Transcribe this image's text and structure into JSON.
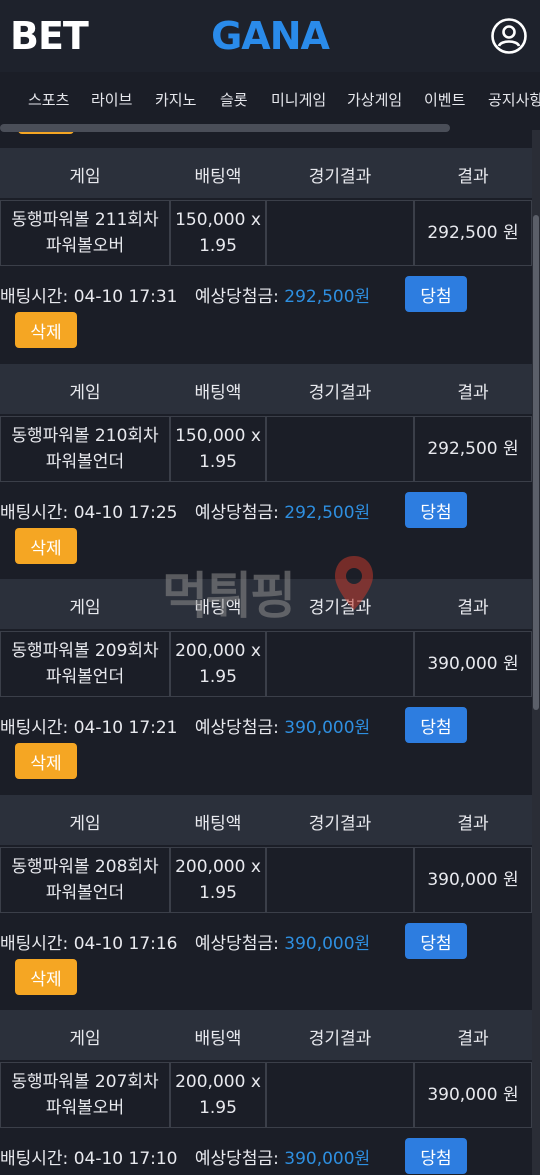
{
  "brand": {
    "logo_part1": "GANA",
    "logo_part2": "BET"
  },
  "nav": {
    "items": [
      "스포츠",
      "라이브",
      "카지노",
      "슬롯",
      "미니게임",
      "가상게임",
      "이벤트",
      "공지사항"
    ]
  },
  "table_headers": [
    "게임",
    "배팅액",
    "경기결과",
    "결과"
  ],
  "labels": {
    "bet_time": "배팅시간:",
    "expected_win": "예상당첨금:",
    "win_button": "당첨",
    "delete_button": "삭제"
  },
  "bets": [
    {
      "game_line1": "동행파워볼 211회차",
      "game_line2": "파워볼오버",
      "amount_line1": "150,000 x",
      "amount_line2": "1.95",
      "match_result": "",
      "result": "292,500 원",
      "bet_time": "04-10 17:31",
      "expected_win": "292,500원"
    },
    {
      "game_line1": "동행파워볼 210회차",
      "game_line2": "파워볼언더",
      "amount_line1": "150,000 x",
      "amount_line2": "1.95",
      "match_result": "",
      "result": "292,500 원",
      "bet_time": "04-10 17:25",
      "expected_win": "292,500원"
    },
    {
      "game_line1": "동행파워볼 209회차",
      "game_line2": "파워볼언더",
      "amount_line1": "200,000 x",
      "amount_line2": "1.95",
      "match_result": "",
      "result": "390,000 원",
      "bet_time": "04-10 17:21",
      "expected_win": "390,000원"
    },
    {
      "game_line1": "동행파워볼 208회차",
      "game_line2": "파워볼언더",
      "amount_line1": "200,000 x",
      "amount_line2": "1.95",
      "match_result": "",
      "result": "390,000 원",
      "bet_time": "04-10 17:16",
      "expected_win": "390,000원"
    },
    {
      "game_line1": "동행파워볼 207회차",
      "game_line2": "파워볼오버",
      "amount_line1": "200,000 x",
      "amount_line2": "1.95",
      "match_result": "",
      "result": "390,000 원",
      "bet_time": "04-10 17:10",
      "expected_win": "390,000원"
    }
  ],
  "watermark": {
    "text": "먹튀핑"
  },
  "colors": {
    "background": "#1b1e27",
    "header_row": "#2b303b",
    "accent_blue": "#2d7de0",
    "accent_orange": "#f5a623",
    "expected_win_text": "#2e8fe0"
  },
  "icons": {
    "account": "user-circle-icon"
  }
}
